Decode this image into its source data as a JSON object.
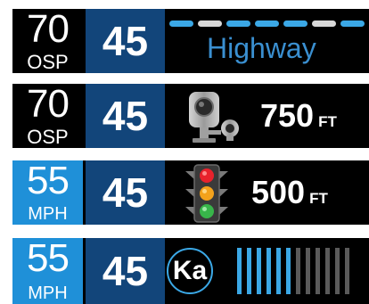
{
  "panels": [
    {
      "limit": {
        "value": "70",
        "unit": "OSP"
      },
      "speed": "45",
      "segments": [
        "blue",
        "light",
        "blue",
        "blue",
        "blue",
        "light",
        "blue"
      ],
      "label": "Highway"
    },
    {
      "limit": {
        "value": "70",
        "unit": "OSP"
      },
      "speed": "45",
      "icon": "speed-camera-icon",
      "distance": {
        "value": "750",
        "unit": "FT"
      }
    },
    {
      "limit": {
        "value": "55",
        "unit": "MPH"
      },
      "speed": "45",
      "icon": "traffic-light-icon",
      "distance": {
        "value": "500",
        "unit": "FT"
      }
    },
    {
      "limit": {
        "value": "55",
        "unit": "MPH"
      },
      "speed": "45",
      "band": "Ka",
      "signal_strength": {
        "active": 6,
        "total": 12
      }
    }
  ],
  "colors": {
    "accent_blue": "#1f90d8",
    "speed_box": "#12457a",
    "band_blue": "#3ba8e6",
    "bar_inactive": "#5a5a5a"
  }
}
